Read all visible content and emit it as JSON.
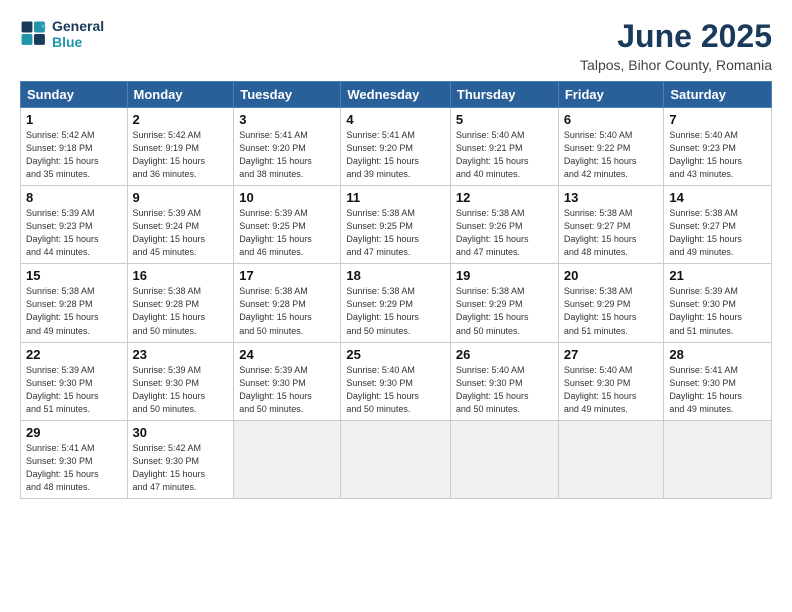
{
  "logo": {
    "line1": "General",
    "line2": "Blue"
  },
  "title": "June 2025",
  "subtitle": "Talpos, Bihor County, Romania",
  "weekdays": [
    "Sunday",
    "Monday",
    "Tuesday",
    "Wednesday",
    "Thursday",
    "Friday",
    "Saturday"
  ],
  "weeks": [
    [
      {
        "day": "1",
        "info": "Sunrise: 5:42 AM\nSunset: 9:18 PM\nDaylight: 15 hours\nand 35 minutes."
      },
      {
        "day": "2",
        "info": "Sunrise: 5:42 AM\nSunset: 9:19 PM\nDaylight: 15 hours\nand 36 minutes."
      },
      {
        "day": "3",
        "info": "Sunrise: 5:41 AM\nSunset: 9:20 PM\nDaylight: 15 hours\nand 38 minutes."
      },
      {
        "day": "4",
        "info": "Sunrise: 5:41 AM\nSunset: 9:20 PM\nDaylight: 15 hours\nand 39 minutes."
      },
      {
        "day": "5",
        "info": "Sunrise: 5:40 AM\nSunset: 9:21 PM\nDaylight: 15 hours\nand 40 minutes."
      },
      {
        "day": "6",
        "info": "Sunrise: 5:40 AM\nSunset: 9:22 PM\nDaylight: 15 hours\nand 42 minutes."
      },
      {
        "day": "7",
        "info": "Sunrise: 5:40 AM\nSunset: 9:23 PM\nDaylight: 15 hours\nand 43 minutes."
      }
    ],
    [
      {
        "day": "8",
        "info": "Sunrise: 5:39 AM\nSunset: 9:23 PM\nDaylight: 15 hours\nand 44 minutes."
      },
      {
        "day": "9",
        "info": "Sunrise: 5:39 AM\nSunset: 9:24 PM\nDaylight: 15 hours\nand 45 minutes."
      },
      {
        "day": "10",
        "info": "Sunrise: 5:39 AM\nSunset: 9:25 PM\nDaylight: 15 hours\nand 46 minutes."
      },
      {
        "day": "11",
        "info": "Sunrise: 5:38 AM\nSunset: 9:25 PM\nDaylight: 15 hours\nand 47 minutes."
      },
      {
        "day": "12",
        "info": "Sunrise: 5:38 AM\nSunset: 9:26 PM\nDaylight: 15 hours\nand 47 minutes."
      },
      {
        "day": "13",
        "info": "Sunrise: 5:38 AM\nSunset: 9:27 PM\nDaylight: 15 hours\nand 48 minutes."
      },
      {
        "day": "14",
        "info": "Sunrise: 5:38 AM\nSunset: 9:27 PM\nDaylight: 15 hours\nand 49 minutes."
      }
    ],
    [
      {
        "day": "15",
        "info": "Sunrise: 5:38 AM\nSunset: 9:28 PM\nDaylight: 15 hours\nand 49 minutes."
      },
      {
        "day": "16",
        "info": "Sunrise: 5:38 AM\nSunset: 9:28 PM\nDaylight: 15 hours\nand 50 minutes."
      },
      {
        "day": "17",
        "info": "Sunrise: 5:38 AM\nSunset: 9:28 PM\nDaylight: 15 hours\nand 50 minutes."
      },
      {
        "day": "18",
        "info": "Sunrise: 5:38 AM\nSunset: 9:29 PM\nDaylight: 15 hours\nand 50 minutes."
      },
      {
        "day": "19",
        "info": "Sunrise: 5:38 AM\nSunset: 9:29 PM\nDaylight: 15 hours\nand 50 minutes."
      },
      {
        "day": "20",
        "info": "Sunrise: 5:38 AM\nSunset: 9:29 PM\nDaylight: 15 hours\nand 51 minutes."
      },
      {
        "day": "21",
        "info": "Sunrise: 5:39 AM\nSunset: 9:30 PM\nDaylight: 15 hours\nand 51 minutes."
      }
    ],
    [
      {
        "day": "22",
        "info": "Sunrise: 5:39 AM\nSunset: 9:30 PM\nDaylight: 15 hours\nand 51 minutes."
      },
      {
        "day": "23",
        "info": "Sunrise: 5:39 AM\nSunset: 9:30 PM\nDaylight: 15 hours\nand 50 minutes."
      },
      {
        "day": "24",
        "info": "Sunrise: 5:39 AM\nSunset: 9:30 PM\nDaylight: 15 hours\nand 50 minutes."
      },
      {
        "day": "25",
        "info": "Sunrise: 5:40 AM\nSunset: 9:30 PM\nDaylight: 15 hours\nand 50 minutes."
      },
      {
        "day": "26",
        "info": "Sunrise: 5:40 AM\nSunset: 9:30 PM\nDaylight: 15 hours\nand 50 minutes."
      },
      {
        "day": "27",
        "info": "Sunrise: 5:40 AM\nSunset: 9:30 PM\nDaylight: 15 hours\nand 49 minutes."
      },
      {
        "day": "28",
        "info": "Sunrise: 5:41 AM\nSunset: 9:30 PM\nDaylight: 15 hours\nand 49 minutes."
      }
    ],
    [
      {
        "day": "29",
        "info": "Sunrise: 5:41 AM\nSunset: 9:30 PM\nDaylight: 15 hours\nand 48 minutes."
      },
      {
        "day": "30",
        "info": "Sunrise: 5:42 AM\nSunset: 9:30 PM\nDaylight: 15 hours\nand 47 minutes."
      },
      {
        "day": "",
        "info": ""
      },
      {
        "day": "",
        "info": ""
      },
      {
        "day": "",
        "info": ""
      },
      {
        "day": "",
        "info": ""
      },
      {
        "day": "",
        "info": ""
      }
    ]
  ]
}
